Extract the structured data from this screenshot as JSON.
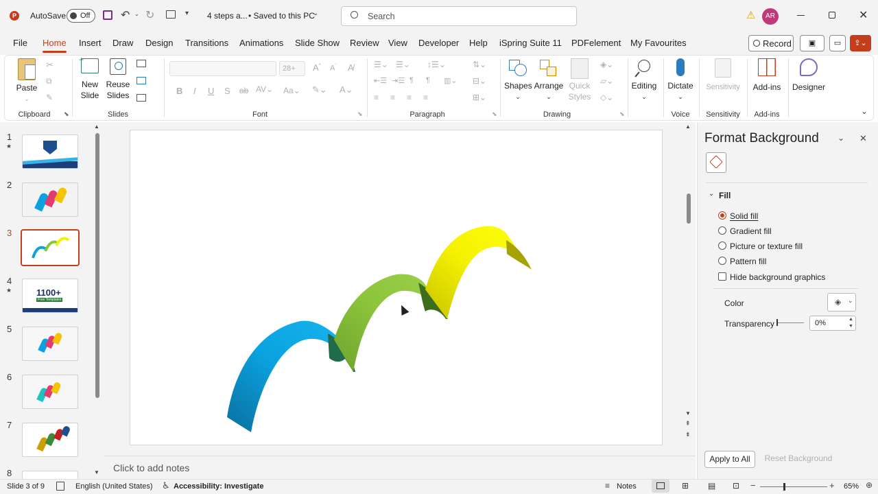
{
  "titlebar": {
    "autosave_label": "AutoSave",
    "autosave_state": "Off",
    "doc_title": "4 steps a...",
    "saved_status": "• Saved to this PC",
    "search_placeholder": "Search",
    "user_initials": "AR"
  },
  "menu": {
    "tabs": [
      "File",
      "Home",
      "Insert",
      "Draw",
      "Design",
      "Transitions",
      "Animations",
      "Slide Show",
      "Review",
      "View",
      "Developer",
      "Help",
      "iSpring Suite 11",
      "PDFelement",
      "My Favourites"
    ],
    "active_tab": "Home",
    "record_label": "Record"
  },
  "ribbon": {
    "clipboard": {
      "paste": "Paste",
      "group": "Clipboard"
    },
    "slides": {
      "new_slide_1": "New",
      "new_slide_2": "Slide",
      "reuse_1": "Reuse",
      "reuse_2": "Slides",
      "group": "Slides"
    },
    "font": {
      "size": "28+",
      "bold": "B",
      "italic": "I",
      "underline": "U",
      "strike": "S",
      "group": "Font"
    },
    "paragraph": {
      "group": "Paragraph"
    },
    "drawing": {
      "shapes": "Shapes",
      "arrange": "Arrange",
      "quick_styles_1": "Quick",
      "quick_styles_2": "Styles",
      "group": "Drawing"
    },
    "editing": {
      "label": "Editing"
    },
    "voice": {
      "dictate": "Dictate",
      "group": "Voice"
    },
    "sensitivity": {
      "label": "Sensitivity",
      "group": "Sensitivity"
    },
    "addins": {
      "label": "Add-ins",
      "group": "Add-ins"
    },
    "designer": {
      "label": "Designer"
    }
  },
  "slides_panel": {
    "numbers": [
      "1",
      "2",
      "3",
      "4",
      "5",
      "6",
      "7",
      "8"
    ],
    "selected": "3",
    "thumb4_text_1": "1100+",
    "thumb4_text_2": "Free Templates"
  },
  "notes": {
    "placeholder": "Click to add notes"
  },
  "format_background": {
    "title": "Format Background",
    "section": "Fill",
    "options": [
      "Solid fill",
      "Gradient fill",
      "Picture or texture fill",
      "Pattern fill"
    ],
    "selected_option": "Solid fill",
    "hide_graphics": "Hide background graphics",
    "hide_graphics_checked": false,
    "color_label": "Color",
    "transparency_label": "Transparency",
    "transparency_value": "0%",
    "apply_all": "Apply to All",
    "reset": "Reset Background"
  },
  "status": {
    "slide_info": "Slide 3 of 9",
    "language": "English (United States)",
    "accessibility": "Accessibility: Investigate",
    "notes_label": "Notes",
    "zoom": "65%"
  },
  "colors": {
    "accent": "#c43e1c",
    "arch_blue": "#0aa3e0",
    "arch_green": "#8cc43c",
    "arch_yellow": "#f5f200"
  }
}
